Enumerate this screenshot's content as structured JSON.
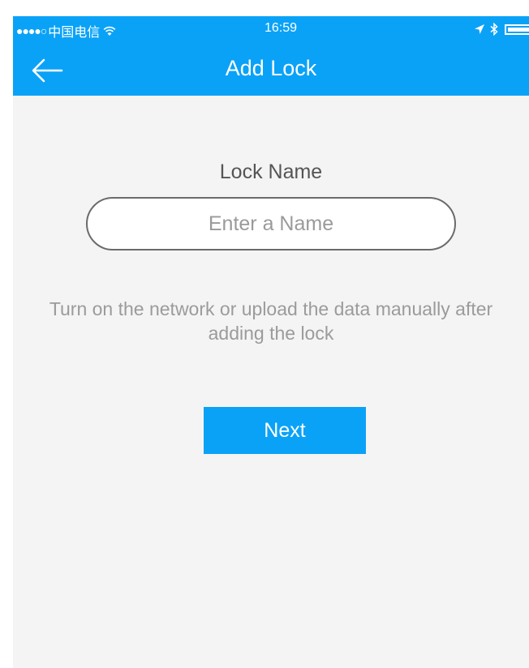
{
  "status_bar": {
    "signal": "●●●●○",
    "carrier": "中国电信",
    "time": "16:59",
    "icons": [
      "wifi-icon",
      "location-arrow-icon",
      "bluetooth-icon",
      "battery-icon"
    ]
  },
  "nav": {
    "back_icon": "back-arrow-icon",
    "title": "Add Lock"
  },
  "form": {
    "label": "Lock Name",
    "input_value": "",
    "input_placeholder": "Enter a Name",
    "hint": "Turn on the network or upload the data manually after adding the lock",
    "next_label": "Next"
  },
  "colors": {
    "accent": "#0aa2f7",
    "background": "#f4f4f4",
    "text_primary": "#555555",
    "text_hint": "#9b9b9b"
  }
}
